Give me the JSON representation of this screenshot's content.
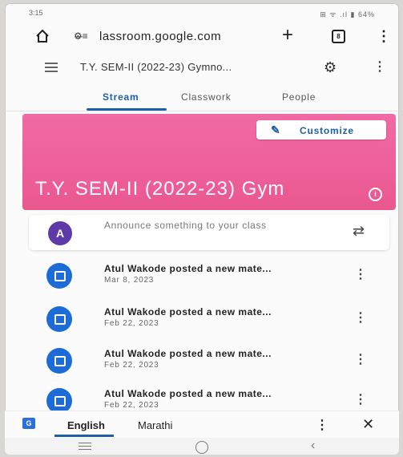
{
  "status_bar": {
    "time": "3:15",
    "indicators": "⊞ ᯤ .ıl ▮ 64%"
  },
  "browser": {
    "url": "lassroom.google.com",
    "icons": [
      "home-icon",
      "site-info-icon",
      "plus-icon",
      "tabs-icon",
      "more-vert-icon"
    ],
    "tab_count": "8"
  },
  "app_bar": {
    "title": "T.Y. SEM-II (2022-23) Gymno..."
  },
  "tabs": [
    {
      "label": "Stream",
      "active": true
    },
    {
      "label": "Classwork",
      "active": false
    },
    {
      "label": "People",
      "active": false
    }
  ],
  "banner": {
    "color": "#ee5f99",
    "customize_label": "Customize",
    "title": "T.Y. SEM-II (2022-23) Gym"
  },
  "announce": {
    "avatar_letter": "A",
    "avatar_color": "#5d3aa8",
    "placeholder": "Announce something to your class"
  },
  "posts": [
    {
      "title": "Atul Wakode posted a new mate...",
      "date": "Mar 8, 2023"
    },
    {
      "title": "Atul Wakode posted a new mate...",
      "date": "Feb 22, 2023"
    },
    {
      "title": "Atul Wakode posted a new mate...",
      "date": "Feb 22, 2023"
    },
    {
      "title": "Atul Wakode posted a new mate...",
      "date": "Feb 22, 2023"
    }
  ],
  "translate_bar": {
    "languages": [
      {
        "label": "English",
        "active": true
      },
      {
        "label": "Marathi",
        "active": false
      }
    ],
    "close_symbol": "✕"
  },
  "accent_color": "#1f5fa8"
}
